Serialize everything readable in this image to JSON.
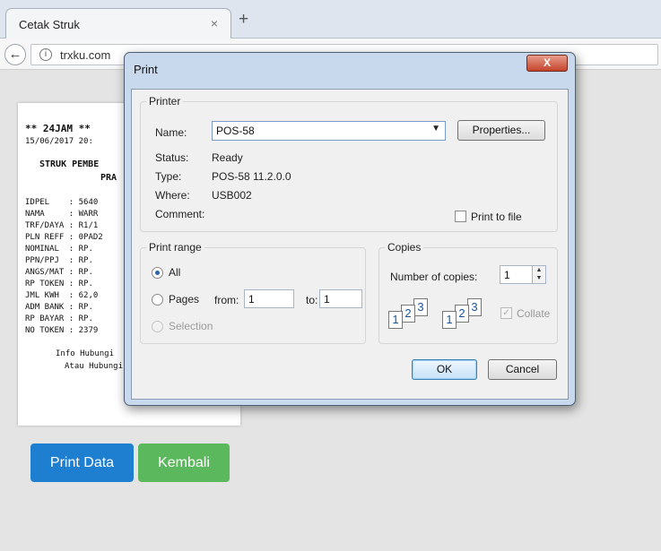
{
  "browser": {
    "tab_title": "Cetak Struk",
    "tab_close": "×",
    "new_tab": "+",
    "back": "←",
    "info": "i",
    "url": "trxku.com"
  },
  "receipt": {
    "lines": [
      "** 24JAM **",
      "15/06/2017 20:",
      "STRUK PEMBE",
      "PRA",
      "IDPEL    : 5640",
      "NAMA     : WARR",
      "TRF/DAYA : R1/1",
      "PLN REFF : 0PAD2",
      "NOMINAL  : RP.",
      "PPN/PPJ  : RP.",
      "ANGS/MAT : RP.",
      "RP TOKEN : RP.",
      "JML KWH  : 62,0",
      "ADM BANK : RP.",
      "RP BAYAR : RP.",
      "NO TOKEN : 2379",
      "Info Hubungi",
      "Atau Hubungi"
    ]
  },
  "page_buttons": {
    "print": "Print Data",
    "back": "Kembali"
  },
  "dialog": {
    "title": "Print",
    "close": "X",
    "printer": {
      "group": "Printer",
      "name_label": "Name:",
      "name_value": "POS-58",
      "properties": "Properties...",
      "status_label": "Status:",
      "status_value": "Ready",
      "type_label": "Type:",
      "type_value": "POS-58 11.2.0.0",
      "where_label": "Where:",
      "where_value": "USB002",
      "comment_label": "Comment:",
      "print_to_file": "Print to file"
    },
    "range": {
      "group": "Print range",
      "all": "All",
      "pages": "Pages",
      "from_label": "from:",
      "from_value": "1",
      "to_label": "to:",
      "to_value": "1",
      "selection": "Selection"
    },
    "copies": {
      "group": "Copies",
      "number_label": "Number of copies:",
      "number_value": "1",
      "collate": "Collate",
      "page_numbers": [
        "1",
        "2",
        "3"
      ]
    },
    "ok": "OK",
    "cancel": "Cancel"
  },
  "colors": {
    "print_button": "#1e7fd1",
    "back_button": "#5cb85c",
    "dialog_frame": "#c8d9ee"
  }
}
